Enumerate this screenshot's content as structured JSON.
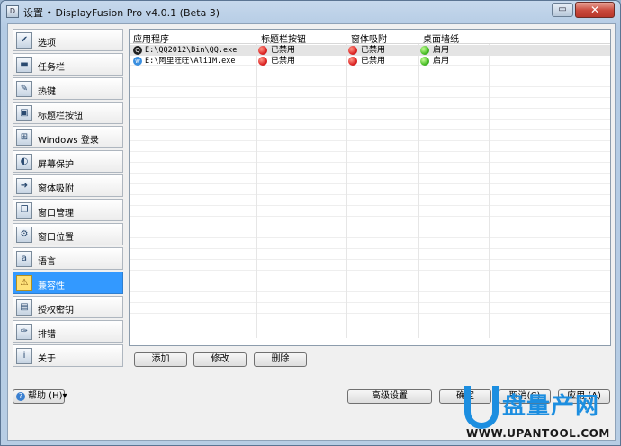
{
  "window": {
    "title": "设置 • DisplayFusion Pro v4.0.1 (Beta 3)",
    "close_glyph": "✕",
    "restore_glyph": "▭"
  },
  "sidebar": {
    "items": [
      {
        "label": "选项",
        "icon": "options-icon",
        "glyph": "✔"
      },
      {
        "label": "任务栏",
        "icon": "taskbar-icon",
        "glyph": "▬"
      },
      {
        "label": "热键",
        "icon": "hotkey-icon",
        "glyph": "✎"
      },
      {
        "label": "标题栏按钮",
        "icon": "titlebar-button-icon",
        "glyph": "▣"
      },
      {
        "label": "Windows 登录",
        "icon": "windows-logo-icon",
        "glyph": "⊞"
      },
      {
        "label": "屏幕保护",
        "icon": "screensaver-icon",
        "glyph": "◐"
      },
      {
        "label": "窗体吸附",
        "icon": "window-snap-icon",
        "glyph": "➜"
      },
      {
        "label": "窗口管理",
        "icon": "window-management-icon",
        "glyph": "❐"
      },
      {
        "label": "窗口位置",
        "icon": "window-position-icon",
        "glyph": "⚙"
      },
      {
        "label": "语言",
        "icon": "language-icon",
        "glyph": "a"
      },
      {
        "label": "兼容性",
        "icon": "warning-icon",
        "glyph": "⚠",
        "selected": true
      },
      {
        "label": "授权密钥",
        "icon": "license-key-icon",
        "glyph": "▤"
      },
      {
        "label": "排错",
        "icon": "troubleshoot-icon",
        "glyph": "✑"
      },
      {
        "label": "关于",
        "icon": "info-icon",
        "glyph": "i"
      }
    ]
  },
  "table": {
    "columns": [
      "应用程序",
      "标题栏按钮",
      "窗体吸附",
      "桌面墙纸"
    ],
    "rows": [
      {
        "app_icon": "qq-icon",
        "app_glyph": "Q",
        "app": "E:\\QQ2012\\Bin\\QQ.exe",
        "titlebar": "已禁用",
        "titlebar_color": "red",
        "snap": "已禁用",
        "snap_color": "red",
        "wallpaper": "启用",
        "wallpaper_color": "green"
      },
      {
        "app_icon": "aliwangwang-icon",
        "app_glyph": "w",
        "app": "E:\\阿里旺旺\\AliIM.exe",
        "titlebar": "已禁用",
        "titlebar_color": "red",
        "snap": "已禁用",
        "snap_color": "red",
        "wallpaper": "启用",
        "wallpaper_color": "green"
      }
    ]
  },
  "actions": {
    "add": "添加",
    "edit": "修改",
    "delete": "删除"
  },
  "footer": {
    "help_label": "帮助 (H)▾",
    "help_glyph": "?",
    "advanced": "高级设置",
    "ok": "确定",
    "cancel": "取消(C)",
    "apply": "应用 (A)"
  },
  "watermark": {
    "title": "盘量产网",
    "url": "WWW.UPANTOOL.COM",
    "color": "#1c8ee0"
  }
}
